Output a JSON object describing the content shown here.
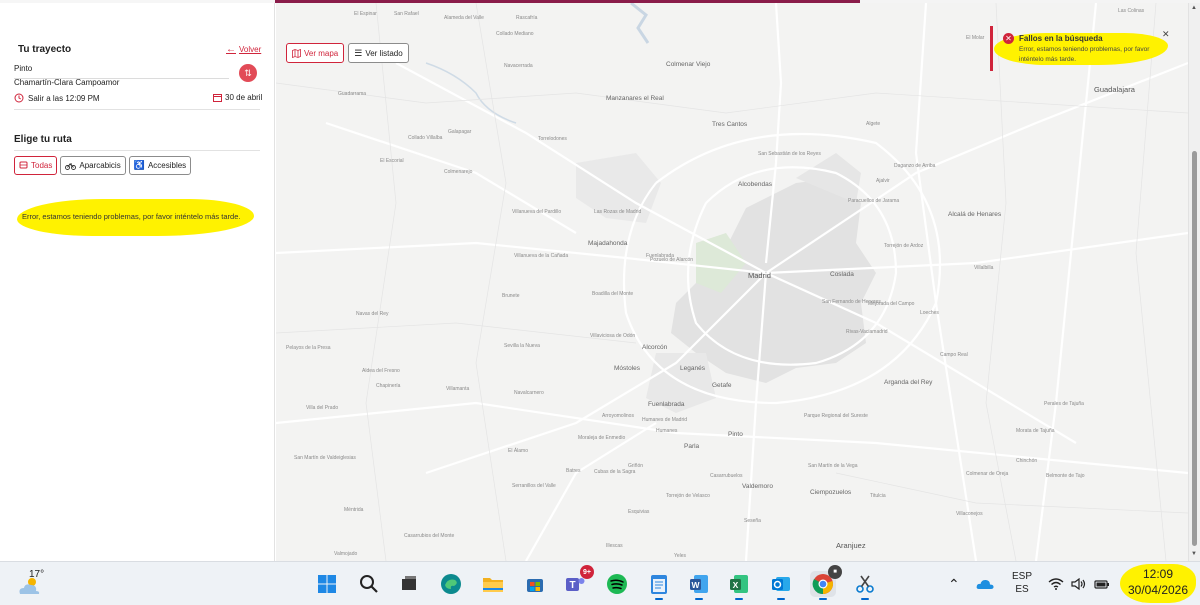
{
  "left_panel": {
    "title": "Tu trayecto",
    "back_label": "Volver",
    "origin": "Pinto",
    "destination": "Chamartín-Clara Campoamor",
    "depart_label": "Salir a las 12:09 PM",
    "date_label": "30 de abril",
    "route_title": "Elige tu ruta",
    "filters": [
      {
        "label": "Todas",
        "icon": "train-icon"
      },
      {
        "label": "Aparcabicis",
        "icon": "bike-icon"
      },
      {
        "label": "Accesibles",
        "icon": "wheelchair-icon"
      }
    ],
    "error_message": "Error, estamos teniendo problemas, por favor inténtelo más tarde."
  },
  "map": {
    "view_map_label": "Ver mapa",
    "view_list_label": "Ver listado",
    "labels": [
      {
        "text": "El Espinar"
      },
      {
        "text": "San Rafael"
      },
      {
        "text": "Alameda del Valle"
      },
      {
        "text": "Rascafría"
      },
      {
        "text": "El Molar"
      },
      {
        "text": "Las Colinas"
      },
      {
        "text": "Collado Mediano"
      },
      {
        "text": "Navacerrada"
      },
      {
        "text": "Manzanares el Real"
      },
      {
        "text": "Colmenar Viejo"
      },
      {
        "text": "Tres Cantos"
      },
      {
        "text": "Algete"
      },
      {
        "text": "Guadalajara"
      },
      {
        "text": "Torrelodones"
      },
      {
        "text": "Las Rozas de Madrid"
      },
      {
        "text": "Majadahonda"
      },
      {
        "text": "Pozuelo de Alarcón"
      },
      {
        "text": "Madrid"
      },
      {
        "text": "Alcobendas"
      },
      {
        "text": "San Sebastián de los Reyes"
      },
      {
        "text": "Coslada"
      },
      {
        "text": "Torrejón de Ardoz"
      },
      {
        "text": "Alcalá de Henares"
      },
      {
        "text": "Móstoles"
      },
      {
        "text": "Leganés"
      },
      {
        "text": "Getafe"
      },
      {
        "text": "Fuenlabrada"
      },
      {
        "text": "Alcorcón"
      },
      {
        "text": "Parla"
      },
      {
        "text": "Pinto"
      },
      {
        "text": "Valdemoro"
      },
      {
        "text": "Boadilla del Monte"
      },
      {
        "text": "Villaviciosa de Odón"
      },
      {
        "text": "Rivas-Vaciamadrid"
      },
      {
        "text": "Arganda del Rey"
      },
      {
        "text": "Mejorada del Campo"
      },
      {
        "text": "San Fernando de Henares"
      },
      {
        "text": "Villalbilla"
      },
      {
        "text": "Navalcarnero"
      },
      {
        "text": "Ciempozuelos"
      },
      {
        "text": "Aranjuez"
      },
      {
        "text": "Chinchón"
      },
      {
        "text": "Colmenarejo"
      },
      {
        "text": "Galapagar"
      },
      {
        "text": "Guadarrama"
      },
      {
        "text": "El Escorial"
      },
      {
        "text": "Collado Villalba"
      },
      {
        "text": "Villanueva de la Cañada"
      },
      {
        "text": "Villanueva del Pardillo"
      },
      {
        "text": "Brunete"
      },
      {
        "text": "Sevilla la Nueva"
      },
      {
        "text": "El Álamo"
      },
      {
        "text": "Griñón"
      },
      {
        "text": "Torrejón de Velasco"
      },
      {
        "text": "Humanes de Madrid"
      },
      {
        "text": "Moraleja de Enmedio"
      },
      {
        "text": "Paracuellos de Jarama"
      },
      {
        "text": "Ajalvir"
      },
      {
        "text": "Daganzo de Arriba"
      },
      {
        "text": "Loeches"
      },
      {
        "text": "Campo Real"
      },
      {
        "text": "Perales de Tajuña"
      },
      {
        "text": "Morata de Tajuña"
      },
      {
        "text": "San Martín de la Vega"
      },
      {
        "text": "Titulcia"
      },
      {
        "text": "Villaconejos"
      },
      {
        "text": "Colmenar de Oreja"
      },
      {
        "text": "Belmonte de Tajo"
      },
      {
        "text": "Casarrubuelos"
      },
      {
        "text": "Cubas de la Sagra"
      },
      {
        "text": "Batres"
      },
      {
        "text": "Serranillos del Valle"
      },
      {
        "text": "Yeles"
      },
      {
        "text": "Esquivias"
      },
      {
        "text": "Illescas"
      },
      {
        "text": "Seseña"
      },
      {
        "text": "Valmojado"
      },
      {
        "text": "Casarrubios del Monte"
      },
      {
        "text": "Méntrida"
      },
      {
        "text": "Chapinería"
      },
      {
        "text": "Navas del Rey"
      },
      {
        "text": "Pelayos de la Presa"
      },
      {
        "text": "San Martín de Valdeiglesias"
      },
      {
        "text": "Aldea del Fresno"
      },
      {
        "text": "Villamanta"
      },
      {
        "text": "Villa del Prado"
      },
      {
        "text": "Fuenlabrada"
      },
      {
        "text": "Humanes"
      },
      {
        "text": "Arroyomolinos"
      },
      {
        "text": "Parque Regional del Sureste"
      }
    ]
  },
  "toast": {
    "title": "Fallos en la búsqueda",
    "message": "Error, estamos teniendo problemas, por favor inténtelo más tarde."
  },
  "taskbar": {
    "temperature": "17°",
    "teams_badge": "9+",
    "lang_primary": "ESP",
    "lang_secondary": "ES",
    "time": "12:09",
    "date": "30/04/2026",
    "apps": [
      {
        "name": "start-icon",
        "color": "#1e88e5"
      },
      {
        "name": "search-icon",
        "color": "#222222"
      },
      {
        "name": "task-view-icon",
        "color": "#222222"
      },
      {
        "name": "edge-icon",
        "color": "#0c8a8e"
      },
      {
        "name": "file-explorer-icon",
        "color": "#f2b01e"
      },
      {
        "name": "store-icon",
        "color": "#2b6cb0"
      },
      {
        "name": "teams-icon",
        "color": "#5b5fc7"
      },
      {
        "name": "spotify-icon",
        "color": "#1db954"
      },
      {
        "name": "notepad-icon",
        "color": "#2e86de"
      },
      {
        "name": "word-icon",
        "color": "#2b579a"
      },
      {
        "name": "excel-icon",
        "color": "#217346"
      },
      {
        "name": "outlook-icon",
        "color": "#0078d4"
      },
      {
        "name": "chrome-icon",
        "color": "#db4437"
      },
      {
        "name": "snipping-tool-icon",
        "color": "#0a7bcf"
      }
    ]
  },
  "colors": {
    "accent": "#d0243b",
    "highlight": "#fff200"
  }
}
